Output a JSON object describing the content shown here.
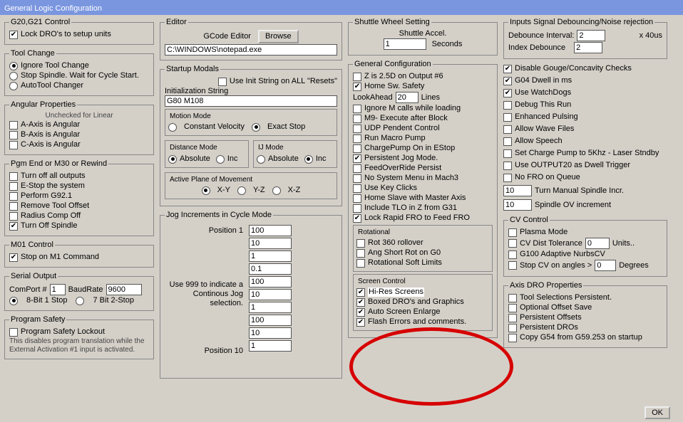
{
  "title": "General Logic Configuration",
  "g20g21": {
    "legend": "G20,G21 Control",
    "lockDRO": "Lock DRO's to setup units"
  },
  "toolchange": {
    "legend": "Tool Change",
    "ignore": "Ignore Tool Change",
    "stopSpindle": "Stop Spindle. Wait for Cycle Start.",
    "autotool": "AutoTool Changer"
  },
  "angular": {
    "legend": "Angular Properties",
    "sub": "Unchecked for Linear",
    "a": "A-Axis is Angular",
    "b": "B-Axis is Angular",
    "c": "C-Axis is Angular"
  },
  "pgmend": {
    "legend": "Pgm End or M30 or Rewind",
    "turnoff": "Turn off all outputs",
    "estop": "E-Stop the system",
    "perform": "Perform G92.1",
    "remove": "Remove Tool Offset",
    "radius": "Radius Comp Off",
    "turnoffspindle": "Turn Off Spindle"
  },
  "m01": {
    "legend": "M01 Control",
    "stop": "Stop on M1 Command"
  },
  "serial": {
    "legend": "Serial Output",
    "comport": "ComPort #",
    "comval": "1",
    "baudrate": "BaudRate",
    "baudval": "9600",
    "eight": "8-Bit 1 Stop",
    "seven": "7 Bit 2-Stop"
  },
  "safety": {
    "legend": "Program Safety",
    "lockout": "Program Safety Lockout",
    "note": "This disables program translation while the External Activation #1 input is activated."
  },
  "editor": {
    "legend": "Editor",
    "gcode": "GCode Editor",
    "browse": "Browse",
    "path": "C:\\WINDOWS\\notepad.exe"
  },
  "startup": {
    "legend": "Startup Modals",
    "useinit": "Use Init String on ALL  \"Resets\"",
    "initlbl": "Initialization String",
    "initval": "G80 M108",
    "motion": "Motion Mode",
    "constant": "Constant Velocity",
    "exact": "Exact Stop",
    "distance": "Distance Mode",
    "ij": "IJ Mode",
    "abs": "Absolute",
    "inc": "Inc",
    "active": "Active Plane of Movement",
    "xy": "X-Y",
    "yz": "Y-Z",
    "xz": "X-Z"
  },
  "jog": {
    "legend": "Jog Increments in Cycle Mode",
    "pos1": "Position 1",
    "pos10": "Position 10",
    "use999": "Use 999 to indicate a Continous Jog selection.",
    "v": [
      "100",
      "10",
      "1",
      "0.1",
      "100",
      "10",
      "1",
      "100",
      "10",
      "1"
    ]
  },
  "shuttle": {
    "legend": "Shuttle Wheel Setting",
    "accel": "Shuttle Accel.",
    "val": "1",
    "sec": "Seconds"
  },
  "general": {
    "legend": "General Configuration",
    "z25": "Z is 2.5D on Output #6",
    "homesafe": "Home Sw. Safety",
    "lookahead": "LookAhead",
    "lookval": "20",
    "lines": "Lines",
    "ignoreM": "Ignore M calls while loading",
    "m9": "M9- Execute after Block",
    "udp": "UDP Pendent Control",
    "runmacro": "Run Macro Pump",
    "charge": "ChargePump On in EStop",
    "pjog": "Persistent Jog Mode.",
    "feedov": "FeedOverRide Persist",
    "nosys": "No System Menu in Mach3",
    "keyclicks": "Use Key Clicks",
    "homeslave": "Home Slave with Master Axis",
    "tlo": "Include TLO in Z from G31",
    "lockrapid": "Lock Rapid FRO to Feed FRO"
  },
  "rotational": {
    "legend": "Rotational",
    "rot360": "Rot 360 rollover",
    "angshort": "Ang Short Rot on G0",
    "softlim": "Rotational Soft Limits"
  },
  "screen": {
    "legend": "Screen Control",
    "hires": "Hi-Res Screens",
    "boxed": "Boxed DRO's and Graphics",
    "autoenl": "Auto Screen Enlarge",
    "flash": "Flash Errors and comments."
  },
  "debounce": {
    "legend": "Inputs Signal Debouncing/Noise rejection",
    "dint": "Debounce Interval:",
    "dval": "2",
    "idx": "Index Debounce",
    "idxval": "2",
    "x40": "x 40us"
  },
  "rightcol": {
    "gouge": "Disable Gouge/Concavity Checks",
    "g04": "G04 Dwell in ms",
    "watch": "Use WatchDogs",
    "debug": "Debug This Run",
    "enhanced": "Enhanced Pulsing",
    "wave": "Allow Wave Files",
    "speech": "Allow Speech",
    "setcharge": "Set Charge Pump to 5Khz  -  Laser Stndby",
    "output20": "Use OUTPUT20 as Dwell Trigger",
    "nofro": "No FRO on Queue",
    "man": "Turn Manual Spindle Incr.",
    "manval": "10",
    "spov": "Spindle OV increment",
    "spovval": "10"
  },
  "cv": {
    "legend": "CV Control",
    "plasma": "Plasma Mode",
    "cvdist": "CV Dist Tolerance",
    "cvdistval": "0",
    "units": "Units..",
    "g100": "G100 Adaptive NurbsCV",
    "stopcv": "Stop CV on angles >",
    "stopcvval": "0",
    "deg": "Degrees"
  },
  "axisdro": {
    "legend": "Axis DRO Properties",
    "toolsel": "Tool Selections Persistent.",
    "optoff": "Optional Offset Save",
    "persoff": "Persistent Offsets",
    "persdro": "Persistent DROs",
    "copyG54": "Copy G54 from G59.253 on startup"
  },
  "ok": "OK"
}
